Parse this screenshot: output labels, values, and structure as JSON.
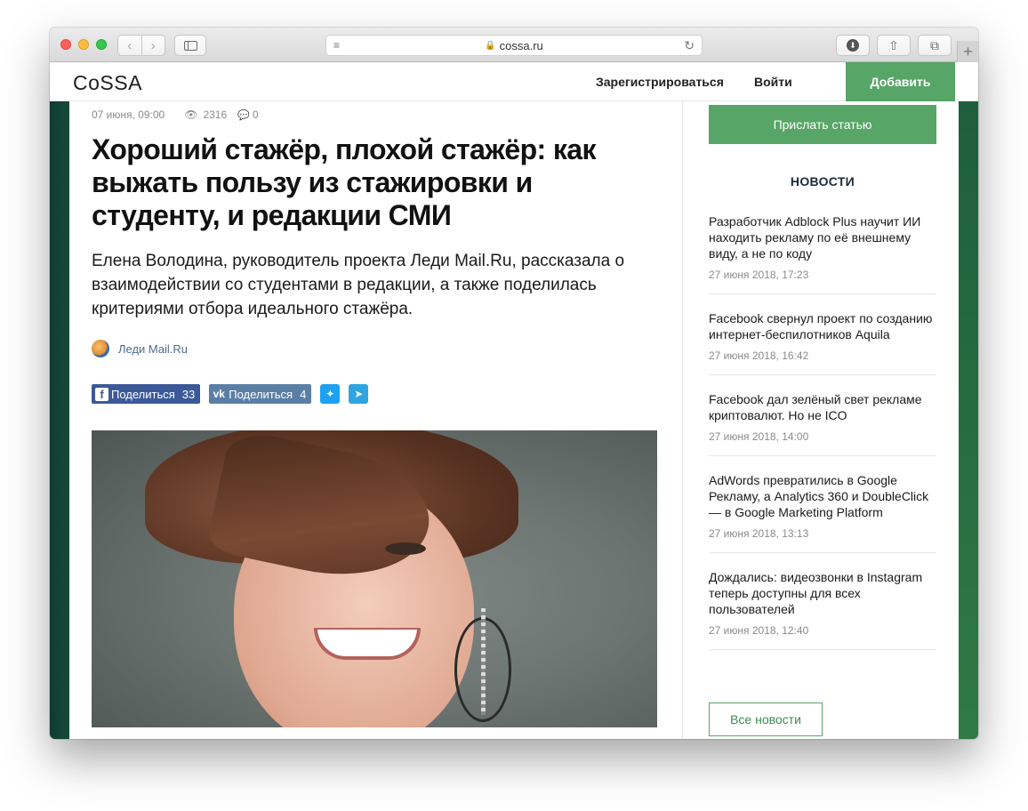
{
  "browser": {
    "address": "cossa.ru",
    "nav_back": "‹",
    "nav_forward": "›",
    "reader_icon": "≡",
    "reload_icon": "↻",
    "lock_icon": "🔒",
    "download_icon": "⬇",
    "share_icon": "⇧",
    "tabs_icon": "⧉",
    "new_tab_icon": "+"
  },
  "header": {
    "logo": "CoSSA",
    "register": "Зарегистрироваться",
    "login": "Войти",
    "add": "Добавить"
  },
  "article": {
    "date": "07 июня, 09:00",
    "views_icon": "👁",
    "views": "2316",
    "comments_icon": "💬",
    "comments": "0",
    "title": "Хороший стажёр, плохой стажёр: как выжать пользу из стажировки и студенту, и редакции СМИ",
    "lead": "Елена Володина, руководитель проекта Леди Mail.Ru, рассказала о взаимодействии со студентами в редакции, а также поделилась критериями отбора идеального стажёра.",
    "author": "Леди Mail.Ru",
    "share_fb_icon": "f",
    "share_fb_label": "Поделиться",
    "share_fb_count": "33",
    "share_vk_icon": "vk",
    "share_vk_label": "Поделиться",
    "share_vk_count": "4",
    "twitter_icon": "✦",
    "telegram_icon": "➤"
  },
  "sidebar": {
    "send_article": "Прислать статью",
    "news_heading": "НОВОСТИ",
    "news": [
      {
        "title": "Разработчик Adblock Plus научит ИИ находить рекламу по её внешнему виду, а не по коду",
        "date": "27 июня 2018, 17:23"
      },
      {
        "title": "Facebook свернул проект по созданию интернет-беспилотников Aquila",
        "date": "27 июня 2018, 16:42"
      },
      {
        "title": "Facebook дал зелёный свет рекламе криптовалют. Но не ICO",
        "date": "27 июня 2018, 14:00"
      },
      {
        "title": "AdWords превратились в Google Рекламу, а Analytics 360 и DoubleClick — в Google Marketing Platform",
        "date": "27 июня 2018, 13:13"
      },
      {
        "title": "Дождались: видеозвонки в Instagram теперь доступны для всех пользователей",
        "date": "27 июня 2018, 12:40"
      }
    ],
    "all_news": "Все новости"
  }
}
